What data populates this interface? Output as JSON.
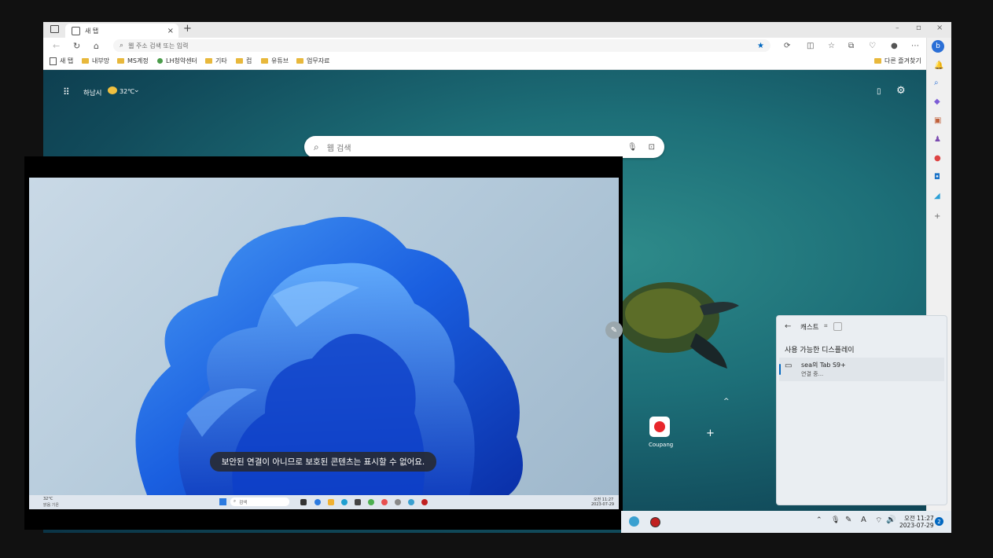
{
  "browser": {
    "tab": {
      "title": "새 탭",
      "close": "×"
    },
    "new_tab": "+",
    "window_controls": [
      "–",
      "▫",
      "×"
    ],
    "address": {
      "placeholder": "웹 주소 검색 또는 입력"
    },
    "favorites": [
      {
        "label": "새 탭",
        "icon": "page-icon"
      },
      {
        "label": "내부망",
        "icon": "folder-icon"
      },
      {
        "label": "MS계정",
        "icon": "folder-icon"
      },
      {
        "label": "LH청약센터",
        "icon": "site-icon"
      },
      {
        "label": "기타",
        "icon": "folder-icon"
      },
      {
        "label": "컵",
        "icon": "folder-icon"
      },
      {
        "label": "유튜브",
        "icon": "folder-icon"
      },
      {
        "label": "업무자료",
        "icon": "folder-icon"
      }
    ],
    "other_favorites": "다른 즐겨찾기"
  },
  "newtab": {
    "weather": {
      "city": "하남시",
      "temp": "32℃"
    },
    "search_placeholder": "웹 검색",
    "tile": {
      "label": "Coupang"
    },
    "add_tile": "+",
    "collapse": "^"
  },
  "cast_panel": {
    "title": "캐스트",
    "section_title": "사용 가능한 디스플레이",
    "device": {
      "name": "sea의 Tab S9+",
      "status": "연결 중..."
    }
  },
  "remote_screen": {
    "toast": "보안된 연결이 아니므로 보호된 콘텐츠는 표시할 수 없어요.",
    "taskbar": {
      "weather_temp": "32°C",
      "weather_desc": "맑음 기온",
      "search": "검색",
      "time": "오전 11:27",
      "date": "2023-07-29"
    }
  },
  "host_taskbar": {
    "time": "오전 11:27",
    "date": "2023-07-29",
    "badge": "2"
  },
  "colors": {
    "accent": "#0067c0",
    "cast_bg": "#eaeef2",
    "coupang_red": "#e8262b"
  }
}
